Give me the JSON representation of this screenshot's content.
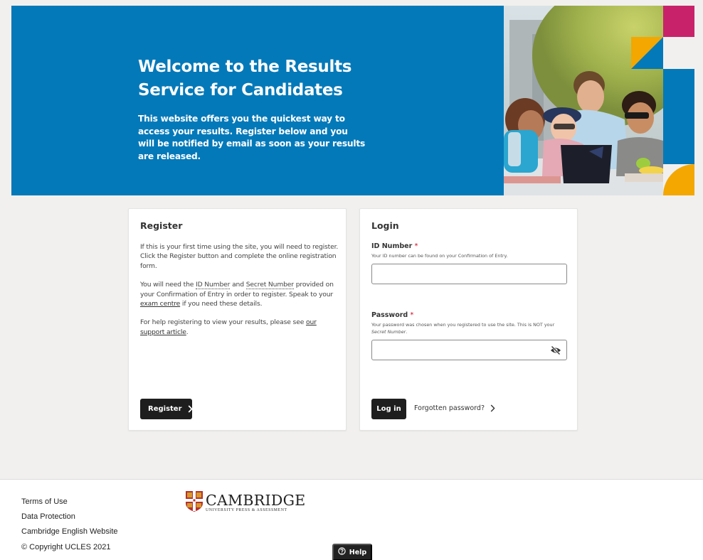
{
  "hero": {
    "title_line1": "Welcome to the Results",
    "title_line2": "Service for Candidates",
    "subtitle": "This website offers you the quickest way to access your results. Register below and you will be notified by email as soon as your results are released.",
    "colors": {
      "blue": "#0479b9",
      "pink": "#c8236a",
      "yellow": "#f3a700"
    },
    "photo_alt": "Four smiling students gathered around a laptop outdoors"
  },
  "register": {
    "title": "Register",
    "para1": "If this is your first time using the site, you will need to register. Click the Register button and complete the online registration form.",
    "para2_before": "You will need the ",
    "para2_id": "ID Number",
    "para2_and": " and ",
    "para2_secret": "Secret Number",
    "para2_mid": " provided on your Confirmation of Entry in order to register. Speak to your ",
    "para2_link": "exam centre",
    "para2_after": " if you need these details.",
    "para3_before": "For help registering to view your results, please see ",
    "para3_link": "our support article",
    "para3_after": ".",
    "button_label": "Register"
  },
  "login": {
    "title": "Login",
    "id_label": "ID Number",
    "id_hint": "Your ID number can be found on your Confirmation of Entry.",
    "id_value": "",
    "password_label": "Password",
    "password_hint_before": "Your password was chosen when you registered to use the site. This is NOT your ",
    "password_hint_italic": "Secret Number",
    "password_hint_after": ".",
    "password_value": "",
    "required_marker": "*",
    "login_button": "Log in",
    "forgot_link": "Forgotten password?"
  },
  "footer": {
    "links": [
      "Terms of Use",
      "Data Protection",
      "Cambridge English Website"
    ],
    "copyright": "© Copyright UCLES 2021",
    "logo_main": "CAMBRIDGE",
    "logo_sub": "UNIVERSITY PRESS & ASSESSMENT",
    "help_label": "Help"
  }
}
